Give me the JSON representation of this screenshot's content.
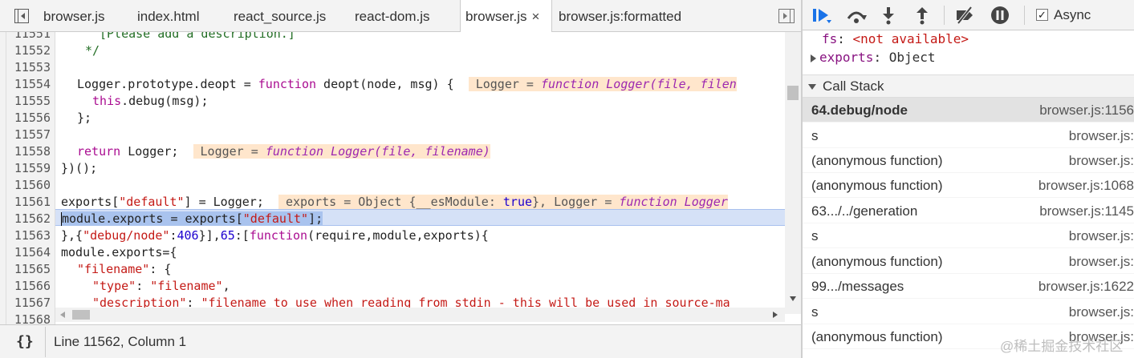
{
  "tabs": [
    {
      "label": "browser.js"
    },
    {
      "label": "index.html"
    },
    {
      "label": "react_source.js"
    },
    {
      "label": "react-dom.js"
    },
    {
      "label": "browser.js",
      "active": true
    },
    {
      "label": "browser.js:formatted"
    }
  ],
  "tab_close_glyph": "×",
  "editor": {
    "line_numbers": [
      "11551",
      "11552",
      "11553",
      "11554",
      "11555",
      "11556",
      "11557",
      "11558",
      "11559",
      "11560",
      "11561",
      "11562",
      "11563",
      "11564",
      "11565",
      "11566",
      "11567",
      "11568"
    ],
    "line_11551": "[Please add a description.]",
    "line_11552": "*/",
    "line_11554_a": "Logger.prototype.deopt = ",
    "line_11554_kw": "function",
    "line_11554_b": " deopt(node, msg) {",
    "line_11554_inline_a": "Logger = ",
    "line_11554_inline_kw": "function",
    "line_11554_inline_b": " Logger(file, filen",
    "line_11555_kw": "this",
    "line_11555_b": ".debug(msg);",
    "line_11556": "};",
    "line_11558_kw": "return",
    "line_11558_b": " Logger;",
    "line_11558_inline_a": "Logger = ",
    "line_11558_inline_kw": "function",
    "line_11558_inline_b": " Logger(file, filename)",
    "line_11559": "})();",
    "line_11561_a": "exports[",
    "line_11561_str": "\"default\"",
    "line_11561_b": "] = Logger;",
    "line_11561_inline_a": "exports = Object {__esModule: ",
    "line_11561_inline_val": "true",
    "line_11561_inline_b": "}, Logger = ",
    "line_11561_inline_kw": "function",
    "line_11561_inline_c": " Logger",
    "line_11562_a": "module.exports = exports[",
    "line_11562_str": "\"default\"",
    "line_11562_b": "];",
    "line_11563_a": "},{",
    "line_11563_str": "\"debug/node\"",
    "line_11563_b": ":",
    "line_11563_num1": "406",
    "line_11563_c": "}],",
    "line_11563_num2": "65",
    "line_11563_d": ":[",
    "line_11563_kw": "function",
    "line_11563_e": "(require,module,exports){",
    "line_11564": "module.exports={",
    "line_11565_str": "\"filename\"",
    "line_11565_b": ": {",
    "line_11566_str1": "\"type\"",
    "line_11566_b": ": ",
    "line_11566_str2": "\"filename\"",
    "line_11566_c": ",",
    "line_11567_str1": "\"description\"",
    "line_11567_b": ": ",
    "line_11567_str2": "\"filename to use when reading from stdin - this will be used in source-ma"
  },
  "status": {
    "pretty_print_label": "{}",
    "cursor_position": "Line 11562, Column 1"
  },
  "debugger_toolbar": {
    "async_label": "Async",
    "async_checked": true,
    "checkmark": "✓"
  },
  "scope": {
    "fs_key": "fs",
    "fs_sep": ": ",
    "fs_value": "<not available>",
    "exports_key": "exports",
    "exports_sep": ": ",
    "exports_value": "Object"
  },
  "call_stack": {
    "title": "Call Stack",
    "frames": [
      {
        "fn": "64.debug/node",
        "loc": "browser.js:1156",
        "active": true
      },
      {
        "fn": "s",
        "loc": "browser.js:"
      },
      {
        "fn": "(anonymous function)",
        "loc": "browser.js:"
      },
      {
        "fn": "(anonymous function)",
        "loc": "browser.js:1068"
      },
      {
        "fn": "63.../../generation",
        "loc": "browser.js:1145"
      },
      {
        "fn": "s",
        "loc": "browser.js:"
      },
      {
        "fn": "(anonymous function)",
        "loc": "browser.js:"
      },
      {
        "fn": "99.../messages",
        "loc": "browser.js:1622"
      },
      {
        "fn": "s",
        "loc": "browser.js:"
      },
      {
        "fn": "(anonymous function)",
        "loc": "browser.js:"
      }
    ]
  },
  "watermark": "@稀土掘金技术社区",
  "colors": {
    "accent_blue": "#1a73e8",
    "inline_value_bg": "#ffe6cc",
    "highlight_line": "#d5e1f7"
  }
}
